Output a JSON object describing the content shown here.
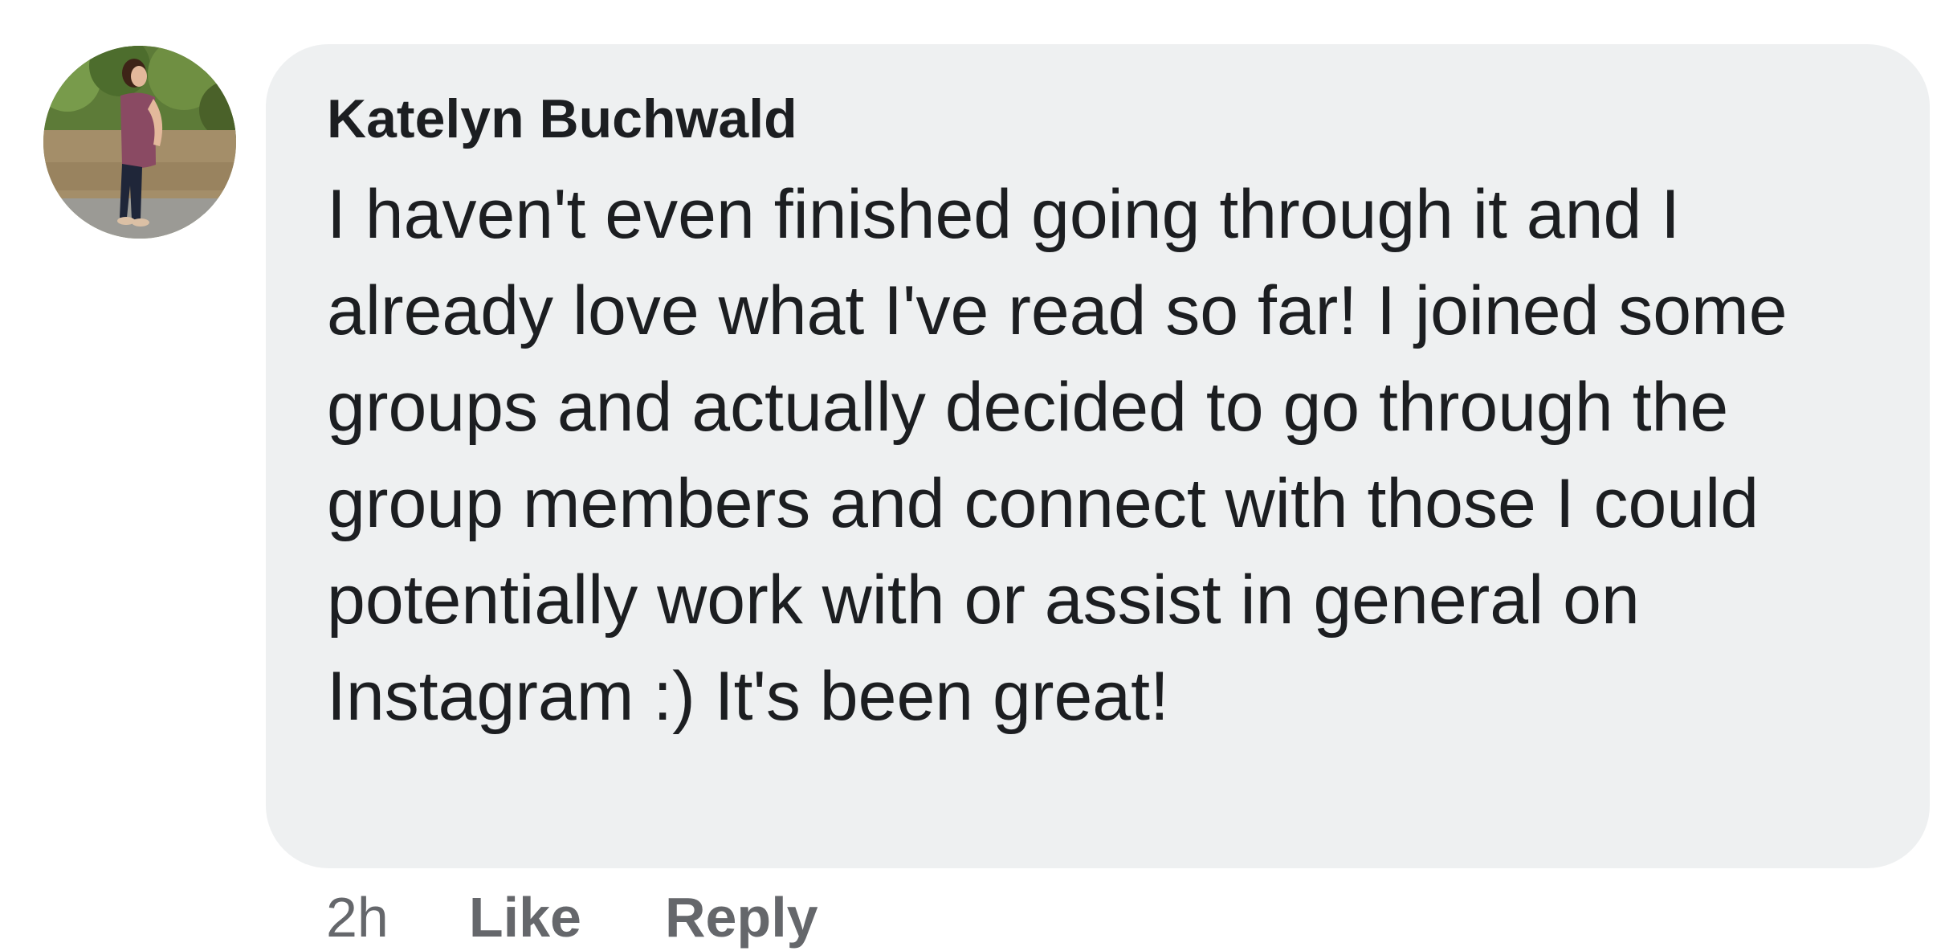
{
  "comment": {
    "author": "Katelyn Buchwald",
    "text": "I haven't even finished going through it and I already love what I've read so far! I joined some groups and actually decided to go through the group members and connect with those I could potentially work with or assist in general on Instagram :) It's been great!",
    "timestamp": "2h",
    "actions": {
      "like_label": "Like",
      "reply_label": "Reply"
    }
  },
  "colors": {
    "bubble_background": "#eef0f1",
    "text": "#1c1e21",
    "secondary_text": "#65676b"
  }
}
